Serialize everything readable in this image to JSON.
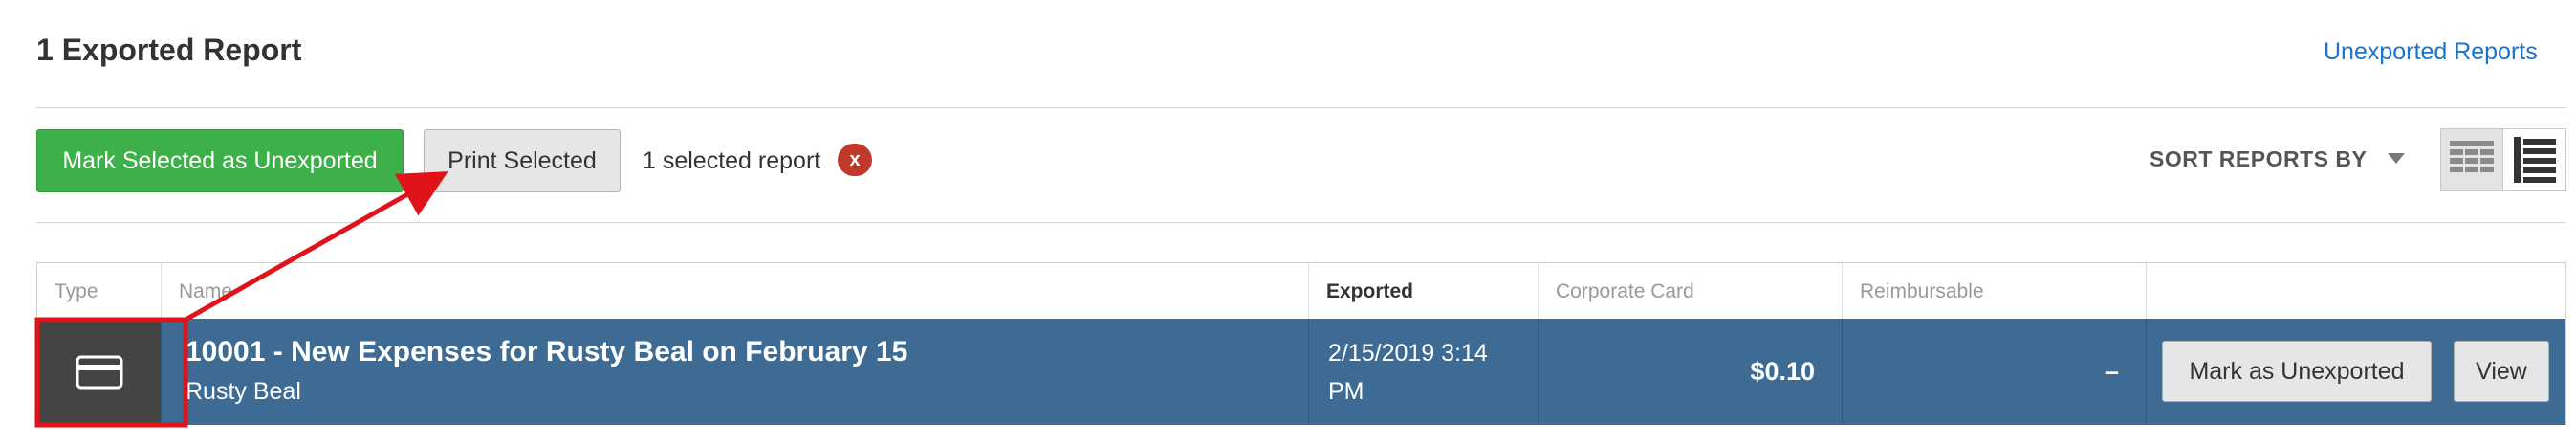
{
  "header": {
    "title": "1 Exported Report",
    "unexported_link": "Unexported Reports"
  },
  "toolbar": {
    "mark_selected_label": "Mark Selected as Unexported",
    "print_selected_label": "Print Selected",
    "selection_text": "1 selected report",
    "clear_selection_label": "x",
    "sort_label": "SORT REPORTS BY",
    "view_modes": [
      "grid-view-icon",
      "list-view-icon"
    ]
  },
  "table": {
    "columns": [
      "Type",
      "Name",
      "Exported",
      "Corporate Card",
      "Reimbursable",
      ""
    ],
    "rows": [
      {
        "type_icon": "credit-card-icon",
        "title": "10001 - New Expenses for Rusty Beal on February 15",
        "submitter": "Rusty Beal",
        "exported_date": "2/15/2019 3:14",
        "exported_time": "PM",
        "corporate_card": "$0.10",
        "reimbursable": "–",
        "mark_unexported_label": "Mark as Unexported",
        "view_label": "View"
      }
    ]
  },
  "colors": {
    "accent_green": "#3eb049",
    "selected_row": "#3d6b94",
    "link_blue": "#1a74c9",
    "badge_red": "#c0392b",
    "annotation_red": "#e0121a"
  }
}
